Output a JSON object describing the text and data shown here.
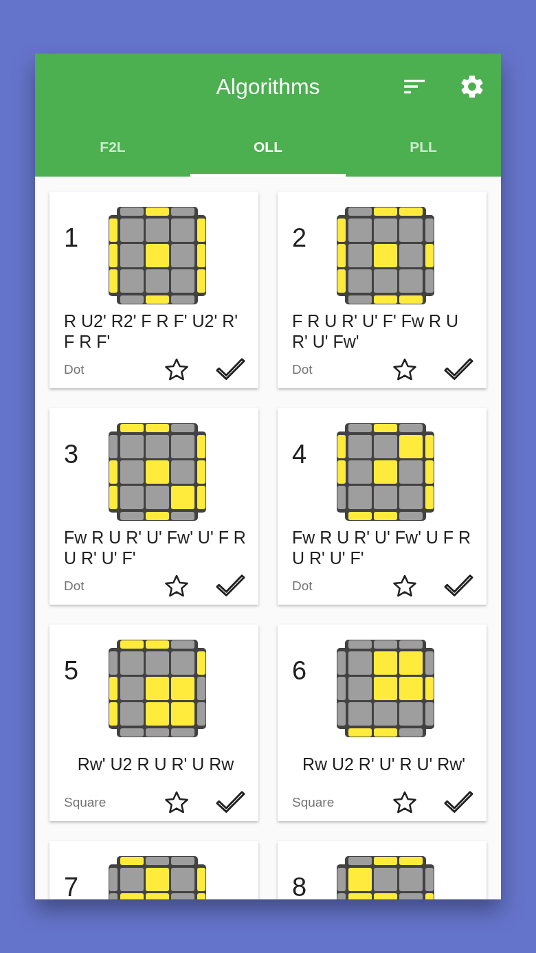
{
  "header": {
    "title": "Algorithms"
  },
  "tabs": [
    {
      "label": "F2L",
      "selected": false
    },
    {
      "label": "OLL",
      "selected": true
    },
    {
      "label": "PLL",
      "selected": false
    }
  ],
  "cards": [
    {
      "number": "1",
      "cube": {
        "top": [
          false,
          true,
          false
        ],
        "rows": [
          {
            "left": true,
            "cells": [
              false,
              false,
              false
            ],
            "right": true
          },
          {
            "left": true,
            "cells": [
              false,
              true,
              false
            ],
            "right": true
          },
          {
            "left": true,
            "cells": [
              false,
              false,
              false
            ],
            "right": true
          }
        ],
        "bottom": [
          false,
          true,
          false
        ]
      },
      "algorithm": "R U2' R2' F R F' U2' R' F R F'",
      "category": "Dot",
      "favorite": false
    },
    {
      "number": "2",
      "cube": {
        "top": [
          false,
          true,
          true
        ],
        "rows": [
          {
            "left": true,
            "cells": [
              false,
              false,
              false
            ],
            "right": false
          },
          {
            "left": true,
            "cells": [
              false,
              true,
              false
            ],
            "right": true
          },
          {
            "left": true,
            "cells": [
              false,
              false,
              false
            ],
            "right": false
          }
        ],
        "bottom": [
          false,
          true,
          true
        ]
      },
      "algorithm": "F R U R' U' F' Fw R U R' U' Fw'",
      "category": "Dot",
      "favorite": false
    },
    {
      "number": "3",
      "cube": {
        "top": [
          true,
          true,
          false
        ],
        "rows": [
          {
            "left": false,
            "cells": [
              false,
              false,
              false
            ],
            "right": true
          },
          {
            "left": true,
            "cells": [
              false,
              true,
              false
            ],
            "right": true
          },
          {
            "left": true,
            "cells": [
              false,
              false,
              true
            ],
            "right": true
          }
        ],
        "bottom": [
          false,
          true,
          false
        ]
      },
      "algorithm": "Fw R U R' U' Fw' U' F R U R' U' F'",
      "category": "Dot",
      "favorite": false
    },
    {
      "number": "4",
      "cube": {
        "top": [
          false,
          true,
          false
        ],
        "rows": [
          {
            "left": true,
            "cells": [
              false,
              false,
              true
            ],
            "right": true
          },
          {
            "left": true,
            "cells": [
              false,
              true,
              false
            ],
            "right": true
          },
          {
            "left": false,
            "cells": [
              false,
              false,
              false
            ],
            "right": true
          }
        ],
        "bottom": [
          true,
          true,
          false
        ]
      },
      "algorithm": "Fw R U R' U' Fw' U F R U R' U' F'",
      "category": "Dot",
      "favorite": false
    },
    {
      "number": "5",
      "cube": {
        "top": [
          true,
          true,
          false
        ],
        "rows": [
          {
            "left": false,
            "cells": [
              false,
              false,
              false
            ],
            "right": true
          },
          {
            "left": true,
            "cells": [
              false,
              true,
              true
            ],
            "right": false
          },
          {
            "left": true,
            "cells": [
              false,
              true,
              true
            ],
            "right": false
          }
        ],
        "bottom": [
          false,
          false,
          false
        ]
      },
      "algorithm": "Rw' U2 R U R' U Rw",
      "category": "Square",
      "favorite": false
    },
    {
      "number": "6",
      "cube": {
        "top": [
          false,
          false,
          false
        ],
        "rows": [
          {
            "left": false,
            "cells": [
              false,
              true,
              true
            ],
            "right": false
          },
          {
            "left": false,
            "cells": [
              false,
              true,
              true
            ],
            "right": true
          },
          {
            "left": false,
            "cells": [
              false,
              false,
              false
            ],
            "right": false
          }
        ],
        "bottom": [
          true,
          true,
          false
        ]
      },
      "algorithm": "Rw U2 R' U' R U' Rw'",
      "category": "Square",
      "favorite": false
    },
    {
      "number": "7",
      "cube": {
        "top": [
          true,
          false,
          false
        ],
        "rows": [
          {
            "left": false,
            "cells": [
              false,
              true,
              false
            ],
            "right": true
          },
          {
            "left": false,
            "cells": [
              true,
              true,
              false
            ],
            "right": true
          }
        ]
      }
    },
    {
      "number": "8",
      "cube": {
        "top": [
          false,
          true,
          true
        ],
        "rows": [
          {
            "left": false,
            "cells": [
              true,
              false,
              false
            ],
            "right": false
          },
          {
            "left": false,
            "cells": [
              true,
              true,
              false
            ],
            "right": true
          }
        ]
      }
    }
  ]
}
